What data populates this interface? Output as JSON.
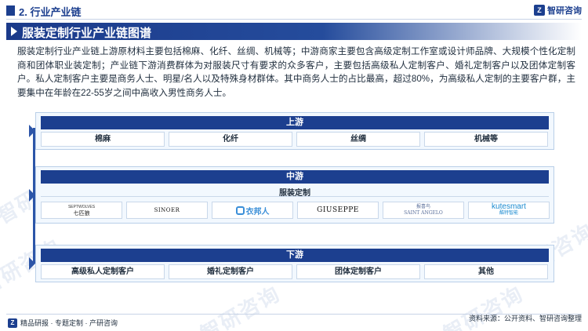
{
  "header": {
    "section_title": "2. 行业产业链",
    "logo_text": "智研咨询",
    "logo_mark": "Z"
  },
  "title": "服装定制行业产业链图谱",
  "paragraph": "服装定制行业产业链上游原材料主要包括棉麻、化纤、丝绸、机械等；中游商家主要包含高级定制工作室或设计师品牌、大规模个性化定制商和团体职业装定制；产业链下游消费群体为对服装尺寸有要求的众多客户，主要包括高级私人定制客户、婚礼定制客户以及团体定制客户。私人定制客户主要是商务人士、明星/名人以及特殊身材群体。其中商务人士的占比最高，超过80%，为高级私人定制的主要客户群，主要集中在年龄在22-55岁之间中高收入男性商务人士。",
  "diagram": {
    "upstream": {
      "label": "上游",
      "items": [
        "棉麻",
        "化纤",
        "丝绸",
        "机械等"
      ]
    },
    "midstream": {
      "label": "中游",
      "sublabel": "服装定制",
      "brands": [
        "七匹狼",
        "SINOER",
        "衣邦人",
        "GIUSEPPE",
        "SAINT ANGELO",
        "kutesmart"
      ],
      "brand_subs": [
        "SEPTWOLVES",
        "",
        "",
        "",
        "报喜鸟",
        "酷特智能"
      ]
    },
    "downstream": {
      "label": "下游",
      "items": [
        "高级私人定制客户",
        "婚礼定制客户",
        "团体定制客户",
        "其他"
      ]
    }
  },
  "footer": {
    "left_text": "精品研报 · 专题定制 · 产研咨询",
    "source": "资料来源：公开资料、智研咨询整理"
  },
  "watermark": "智研咨询",
  "colors": {
    "primary": "#1c3f8f",
    "frame_bg": "#f2f8fe",
    "frame_border": "#b9cfe8"
  }
}
